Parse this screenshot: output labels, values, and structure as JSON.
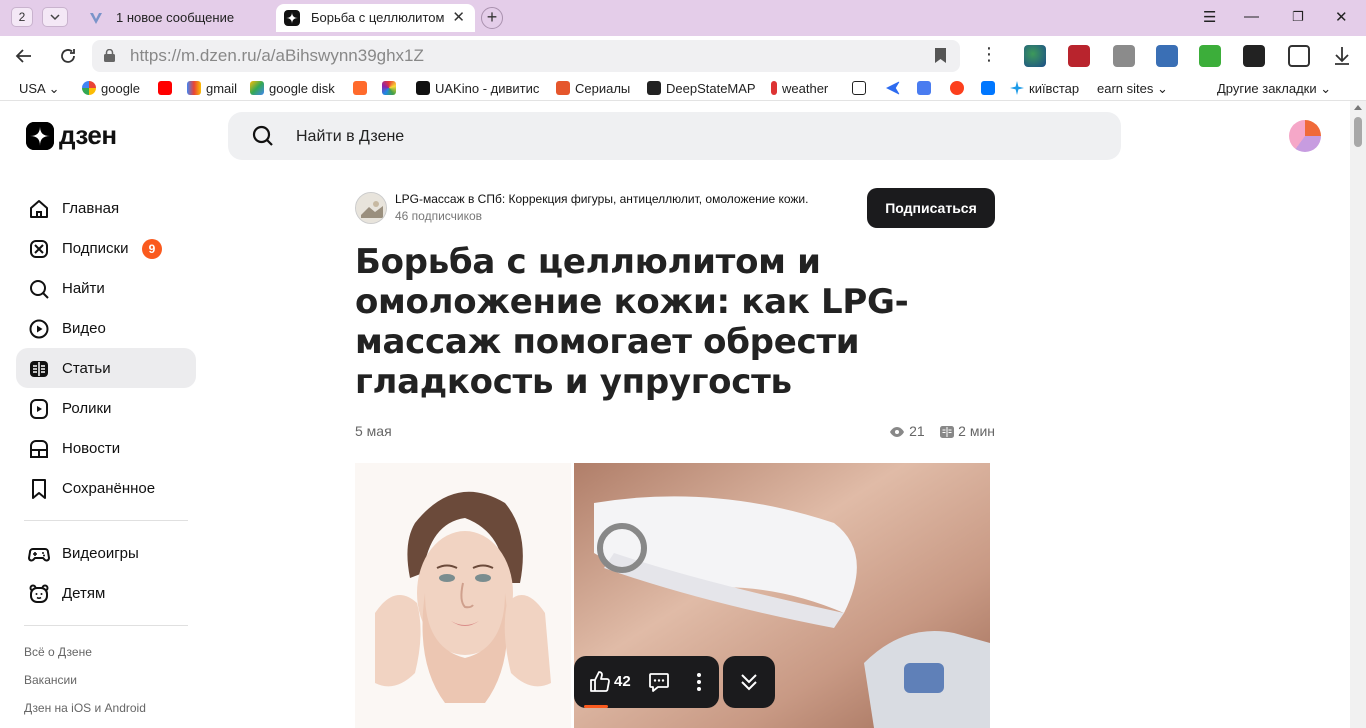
{
  "browser": {
    "tab_count": "2",
    "tabs": [
      {
        "title": "1 новое сообщение",
        "active": false
      },
      {
        "title": "Борьба с целлюлитом и",
        "active": true
      }
    ],
    "url_host": "https://m.dzen.ru",
    "url_path": "/a/aBihswynn39ghx1Z"
  },
  "bookmarks": [
    {
      "label": "USA",
      "icon": "dropdown",
      "color": "#ffffff"
    },
    {
      "label": "google",
      "icon": "google-icon",
      "color": "#4285f4"
    },
    {
      "label": "",
      "icon": "youtube-icon",
      "color": "#ff0000"
    },
    {
      "label": "gmail",
      "icon": "gmail-icon",
      "color": "#ea4335"
    },
    {
      "label": "google disk",
      "icon": "google-drive-icon",
      "color": "#34a853"
    },
    {
      "label": "",
      "icon": "f-icon",
      "color": "#ff6a2c"
    },
    {
      "label": "",
      "icon": "colorful-icon",
      "color": "#7b61ff"
    },
    {
      "label": "UAKino - дивитис",
      "icon": "uakino-icon",
      "color": "#111111"
    },
    {
      "label": "Сериалы",
      "icon": "series-icon",
      "color": "#e5562c"
    },
    {
      "label": "DeepStateMAP",
      "icon": "deepstate-icon",
      "color": "#222222"
    },
    {
      "label": "weather",
      "icon": "thermometer-icon",
      "color": "#d33"
    },
    {
      "label": "",
      "icon": "bc-icon",
      "color": "#222222"
    },
    {
      "label": "",
      "icon": "arrow-icon",
      "color": "#2d6bf0"
    },
    {
      "label": "",
      "icon": "translate-icon",
      "color": "#4a7cf0"
    },
    {
      "label": "",
      "icon": "yandex-icon",
      "color": "#fc3f1d"
    },
    {
      "label": "",
      "icon": "vk-icon",
      "color": "#0077ff"
    },
    {
      "label": "київстар",
      "icon": "kyivstar-icon",
      "color": "#1e9be8"
    },
    {
      "label": "earn sites",
      "icon": "dropdown",
      "color": "#ffffff"
    },
    {
      "label": "Другие закладки",
      "icon": "dropdown",
      "color": "#ffffff"
    }
  ],
  "header": {
    "logo_text": "дзен",
    "search_placeholder": "Найти в Дзене"
  },
  "sidebar": {
    "items": [
      {
        "label": "Главная",
        "icon": "home-icon",
        "active": false
      },
      {
        "label": "Подписки",
        "icon": "subscriptions-icon",
        "active": false,
        "badge": "9"
      },
      {
        "label": "Найти",
        "icon": "search-icon",
        "active": false
      },
      {
        "label": "Видео",
        "icon": "video-icon",
        "active": false
      },
      {
        "label": "Статьи",
        "icon": "articles-icon",
        "active": true
      },
      {
        "label": "Ролики",
        "icon": "clips-icon",
        "active": false
      },
      {
        "label": "Новости",
        "icon": "news-icon",
        "active": false
      },
      {
        "label": "Сохранённое",
        "icon": "bookmark-icon",
        "active": false
      }
    ],
    "extra_items": [
      {
        "label": "Видеоигры",
        "icon": "gamepad-icon"
      },
      {
        "label": "Детям",
        "icon": "kids-icon"
      }
    ],
    "footer_links": [
      "Всё о Дзене",
      "Вакансии",
      "Дзен на iOS и Android"
    ]
  },
  "article": {
    "channel_name": "LPG-массаж в СПб: Коррекция фигуры, антицеллюлит, омоложение кожи.",
    "channel_subscribers": "46 подписчиков",
    "subscribe_label": "Подписаться",
    "title": "Борьба с целлюлитом и омоложение кожи: как LPG-массаж помогает обрести гладкость и упругость",
    "date": "5 мая",
    "views": "21",
    "read_time": "2 мин",
    "likes": "42"
  },
  "colors": {
    "tabstrip": "#e4cde9",
    "accent_orange": "#fa5a1e",
    "dark_button": "#1b1b1d",
    "active_nav_bg": "#ececee"
  }
}
